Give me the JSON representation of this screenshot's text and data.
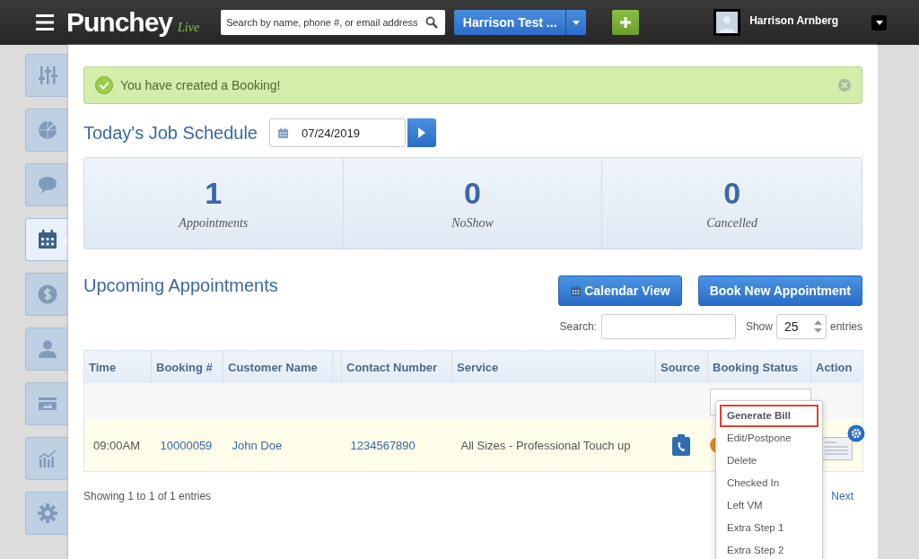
{
  "topbar": {
    "logo": "Punchey",
    "logo_tag": "Live",
    "search": {
      "placeholder": "Search by name, phone #, or email address"
    },
    "business": "Harrison Test ...",
    "user": "Harrison Arnberg"
  },
  "sidebar": {
    "items": [
      {
        "selected": false
      },
      {
        "selected": false
      },
      {
        "selected": false
      },
      {
        "selected": true
      },
      {
        "selected": false
      },
      {
        "selected": false
      },
      {
        "selected": false
      },
      {
        "selected": false
      },
      {
        "selected": false
      }
    ]
  },
  "alert": {
    "message": "You have created a Booking!"
  },
  "schedule": {
    "title": "Today's Job Schedule",
    "date": "07/24/2019"
  },
  "stats": [
    {
      "value": "1",
      "label": "Appointments"
    },
    {
      "value": "0",
      "label": "NoShow"
    },
    {
      "value": "0",
      "label": "Cancelled"
    }
  ],
  "upcoming": {
    "title": "Upcoming Appointments",
    "buttons": [
      {
        "label": "Calendar View",
        "kind": "calendar"
      },
      {
        "label": "Book New Appointment",
        "kind": "plain"
      }
    ],
    "search_label": "Search:",
    "show_label": "Show",
    "page_size": "25",
    "entries_label": "entries"
  },
  "table": {
    "columns": [
      "Time",
      "Booking #",
      "Customer Name",
      "",
      "Contact Number",
      "Service",
      "Source",
      "Booking Status",
      "Action"
    ],
    "rows": [
      {
        "time": "09:00AM",
        "booking": "10000059",
        "customer": "John Doe",
        "contact": "1234567890",
        "service": "All Sizes - Professional Touch up"
      }
    ]
  },
  "footer": {
    "info": "Showing 1 to 1 of 1 entries",
    "next": "Next"
  },
  "status_menu": {
    "items": [
      {
        "label": "Generate Bill",
        "selected": true
      },
      {
        "label": "Edit/Postpone",
        "selected": false
      },
      {
        "label": "Delete",
        "selected": false
      },
      {
        "label": "Checked In",
        "selected": false
      },
      {
        "label": "Left VM",
        "selected": false
      },
      {
        "label": "Extra Step 1",
        "selected": false
      },
      {
        "label": "Extra Step 2",
        "selected": false
      }
    ]
  }
}
